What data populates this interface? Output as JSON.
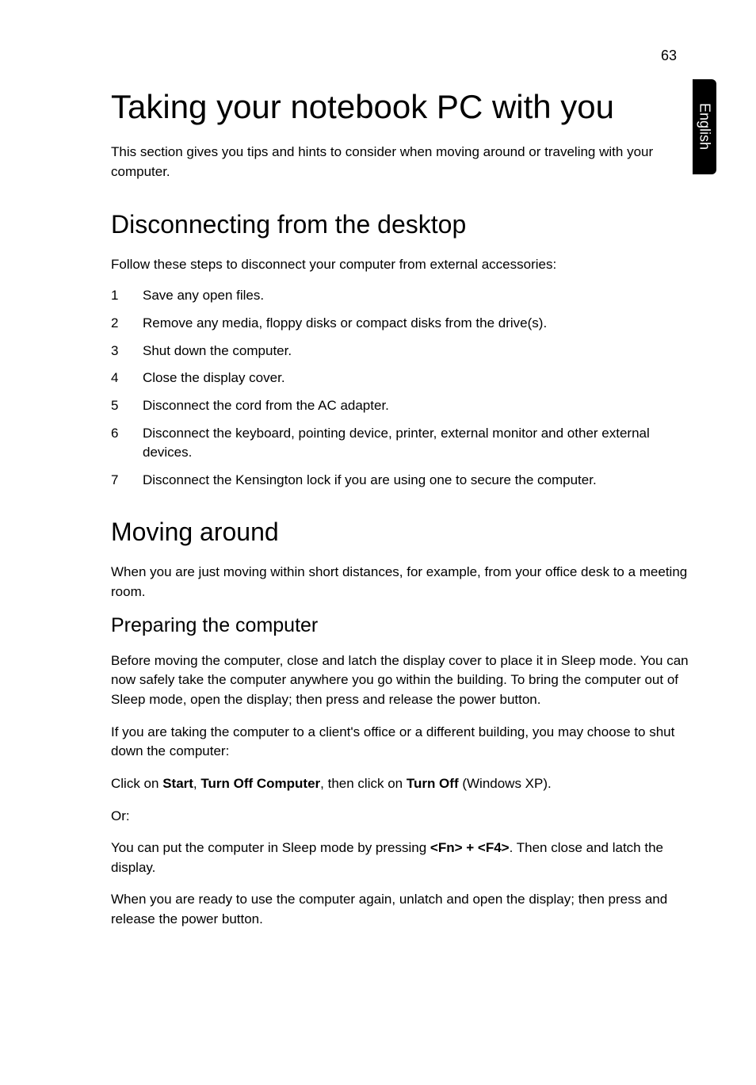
{
  "pageNumber": "63",
  "sideTab": "English",
  "title": "Taking your notebook PC with you",
  "intro": "This section gives you tips and hints to consider when moving around or traveling with your computer.",
  "section1": {
    "heading": "Disconnecting from the desktop",
    "lead": "Follow these steps to disconnect your computer from external accessories:",
    "steps": [
      "Save any open files.",
      "Remove any media, floppy disks or compact disks from the drive(s).",
      "Shut down the computer.",
      "Close the display cover.",
      "Disconnect the cord from the AC adapter.",
      "Disconnect the keyboard, pointing device, printer, external monitor and other external devices.",
      "Disconnect the Kensington lock if you are using one to secure the computer."
    ]
  },
  "section2": {
    "heading": "Moving around",
    "lead": "When you are just moving within short distances, for example, from your office desk to a meeting room.",
    "sub": {
      "heading": "Preparing the computer",
      "p1": "Before moving the computer, close and latch the display cover to place it in Sleep mode. You can now safely take the computer anywhere you go within the building. To bring the computer out of Sleep mode, open the display; then press and release the power button.",
      "p2": "If you are taking the computer to a client's office or a different building, you may choose to shut down the computer:",
      "p3_pre": "Click on ",
      "p3_b1": "Start",
      "p3_mid1": ", ",
      "p3_b2": "Turn Off Computer",
      "p3_mid2": ", then click on ",
      "p3_b3": "Turn Off",
      "p3_post": " (Windows XP).",
      "p4": "Or:",
      "p5_pre": "You can put the computer in Sleep mode by pressing ",
      "p5_b1": "<Fn> + <F4>",
      "p5_post": ". Then close and latch the display.",
      "p6": "When you are ready to use the computer again, unlatch and open the display; then press and release the power button."
    }
  }
}
